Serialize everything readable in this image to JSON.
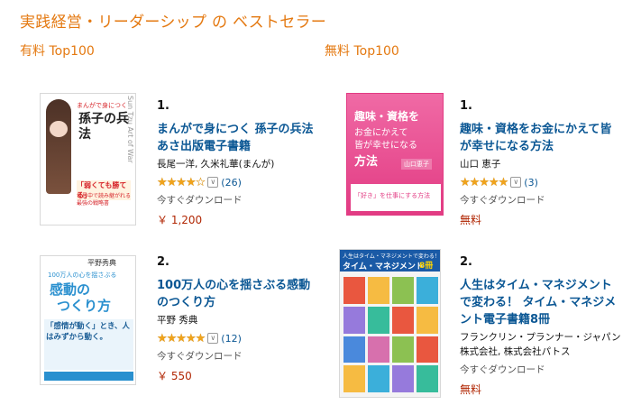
{
  "page": {
    "title": "実践経営・リーダーシップ の ベストセラー",
    "paid_label": "有料 Top100",
    "free_label": "無料 Top100"
  },
  "paid": [
    {
      "rank": "1.",
      "title": "まんがで身につく 孫子の兵法 あさ出版電子書籍",
      "author": "長尾一洋, 久米礼華(まんが)",
      "rating": 4.5,
      "reviews": "(26)",
      "availability": "今すぐダウンロード",
      "price": "￥ 1,200",
      "cover": {
        "top_line": "Sun Tzu Art of War",
        "badge": "まんがで身につく",
        "main": "孫子の兵法",
        "tagline": "「弱くても勝てる」",
        "sub": "世界中で読み継がれる最強の戦略書",
        "colors": {
          "bg": "#ffffff",
          "accent": "#d6252a"
        }
      }
    },
    {
      "rank": "2.",
      "title": "100万人の心を揺さぶる感動のつくり方",
      "author": "平野 秀典",
      "rating": 5,
      "reviews": "(12)",
      "availability": "今すぐダウンロード",
      "price": "￥ 550",
      "cover": {
        "author": "平野秀典",
        "top_line": "100万人の心を揺さぶる",
        "main1": "感動の",
        "main2": "つくり方",
        "phrase": "「感情が動く」とき、人はみずから動く。",
        "colors": {
          "bg": "#ffffff",
          "accent": "#2a90cf"
        }
      }
    }
  ],
  "free": [
    {
      "rank": "1.",
      "title": "趣味・資格をお金にかえて皆が幸せになる方法",
      "author": "山口 恵子",
      "rating": 5,
      "reviews": "(3)",
      "availability": "今すぐダウンロード",
      "price": "無料",
      "cover": {
        "main1": "趣味・資格を",
        "main2": "お金にかえて",
        "main3": "皆が幸せになる",
        "main4": "方法",
        "author": "山口恵子",
        "footer": "「好き」を仕事にする方法",
        "colors": {
          "bg": "#e8458b",
          "accent": "#ffffff"
        }
      }
    },
    {
      "rank": "2.",
      "title": "人生はタイム・マネジメントで変わる！ タイム・マネジメント電子書籍8冊",
      "author": "フランクリン・プランナー・ジャパン株式会社, 株式会社パトス",
      "rating": null,
      "reviews": "",
      "availability": "今すぐダウンロード",
      "price": "無料",
      "cover": {
        "top_line": "人生はタイム・マネジメントで変わる！",
        "main": "タイム・マネジメント",
        "badge": "8冊",
        "colors": {
          "bg": "#f4f4f4",
          "accent": "#1a5aa6"
        }
      }
    }
  ]
}
